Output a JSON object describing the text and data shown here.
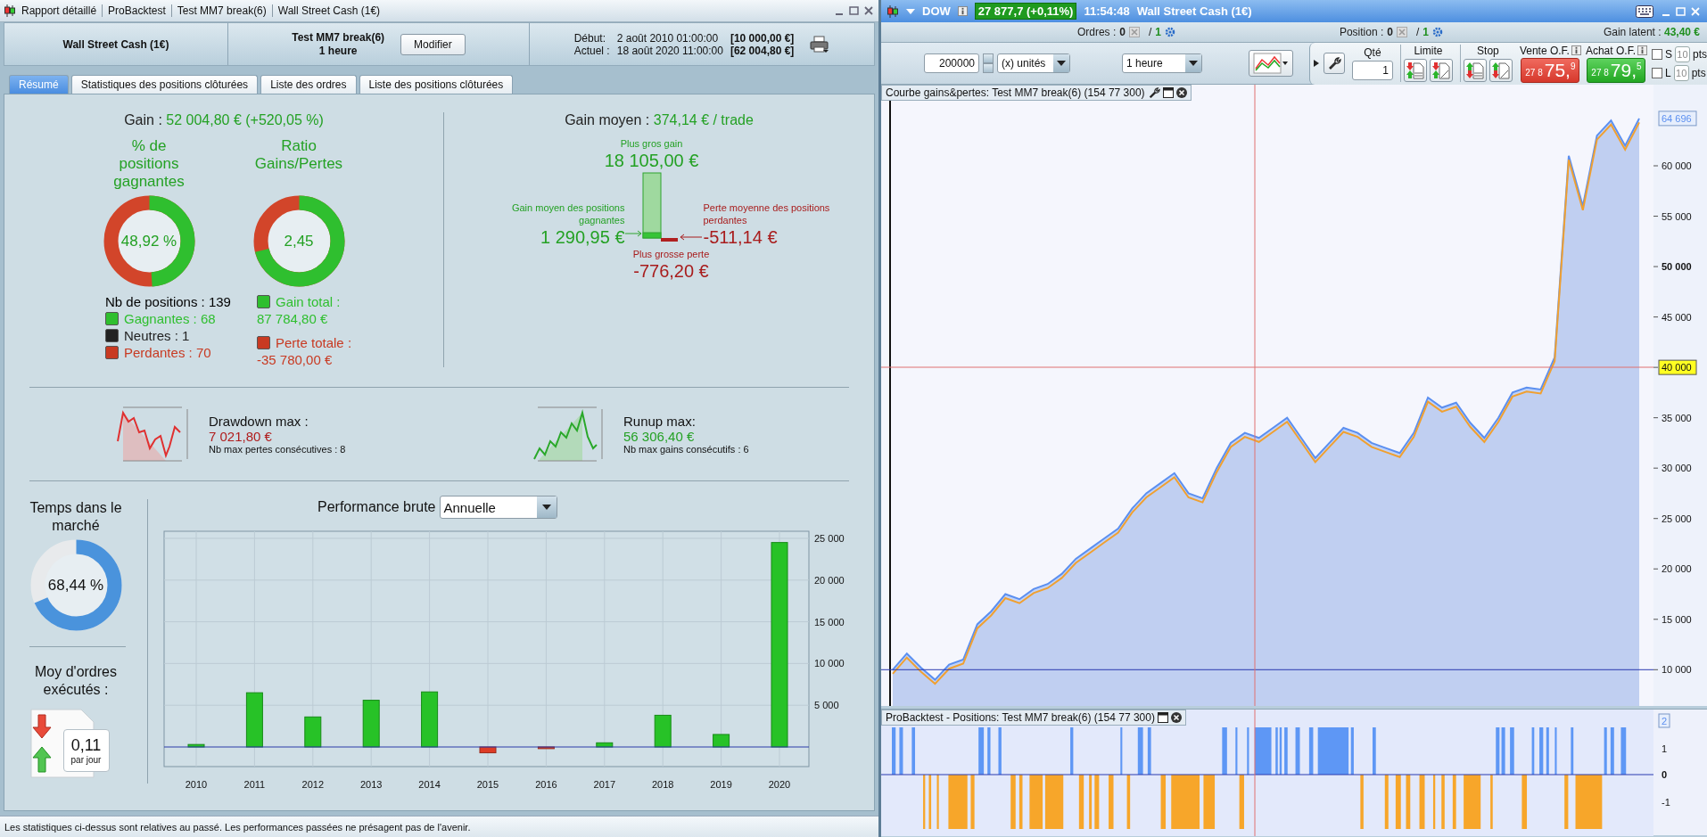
{
  "report_window": {
    "title_items": [
      "Rapport détaillé",
      "ProBacktest",
      "Test MM7 break(6)",
      "Wall Street Cash (1€)"
    ],
    "header": {
      "instrument": "Wall Street Cash (1€)",
      "strategy": "Test MM7 break(6)",
      "timeframe": "1 heure",
      "modify_button": "Modifier",
      "start_label": "Début:",
      "start_date": "2 août 2010 01:00:00",
      "start_value": "[10 000,00 €]",
      "current_label": "Actuel :",
      "current_date": "18 août 2020 11:00:00",
      "current_value": "[62 004,80 €]"
    },
    "tabs": [
      {
        "label": "Résumé",
        "selected": true
      },
      {
        "label": "Statistiques des positions clôturées",
        "selected": false
      },
      {
        "label": "Liste des ordres",
        "selected": false
      },
      {
        "label": "Liste des positions clôturées",
        "selected": false
      }
    ],
    "summary": {
      "gain_label": "Gain :",
      "gain_value": "52 004,80 € (+520,05 %)",
      "win_rate": {
        "title": "% de positions gagnantes",
        "value": "48,92 %",
        "level": 0.4892
      },
      "ratio": {
        "title": "Ratio Gains/Pertes",
        "value": "2,45",
        "level": 0.71
      },
      "positions_count": "Nb de positions : 139",
      "legend": [
        {
          "label": "Gagnantes : 68",
          "color": "#2fbf2f"
        },
        {
          "label": "Neutres : 1",
          "color": "#222222"
        },
        {
          "label": "Perdantes : 70",
          "color": "#c83a22"
        }
      ],
      "totals": [
        {
          "label": "Gain total :",
          "value": "87 784,80 €",
          "color": "#2fbf2f"
        },
        {
          "label": "Perte totale :",
          "value": "-35 780,00 €",
          "color": "#c83a22"
        }
      ],
      "avg_gain_label": "Gain moyen :",
      "avg_gain_value": "374,14 € / trade",
      "best_label": "Plus gros gain",
      "best_value": "18 105,00 €",
      "avg_win_label": "Gain moyen des positions gagnantes",
      "avg_win_value": "1 290,95 €",
      "avg_loss_label": "Perte moyenne des positions perdantes",
      "avg_loss_value": "-511,14 €",
      "worst_label": "Plus grosse perte",
      "worst_value": "-776,20 €",
      "drawdown": {
        "title": "Drawdown max :",
        "value": "7 021,80 €",
        "detail": "Nb max pertes consécutives : 8"
      },
      "runup": {
        "title": "Runup max:",
        "value": "56 306,40 €",
        "detail": "Nb max gains consécutifs : 6"
      },
      "time_in_market": {
        "title": "Temps dans le marché",
        "value": "68,44 %",
        "level": 0.6844
      },
      "orders": {
        "title": "Moy d'ordres exécutés :",
        "value": "0,11",
        "unit": "par jour"
      },
      "performance": {
        "label": "Performance brute",
        "period": "Annuelle",
        "chart_data": {
          "type": "bar",
          "categories": [
            "2010",
            "2011",
            "2012",
            "2013",
            "2014",
            "2015",
            "2016",
            "2017",
            "2018",
            "2019",
            "2020"
          ],
          "values": [
            300,
            6500,
            3600,
            5600,
            6600,
            -700,
            -200,
            500,
            3800,
            1500,
            24500
          ],
          "ylim": [
            -2350,
            25850
          ],
          "grid": true,
          "yticks": [
            {
              "value": 5000,
              "label": "5 000"
            },
            {
              "value": 10000,
              "label": "10 000"
            },
            {
              "value": 15000,
              "label": "15 000"
            },
            {
              "value": 20000,
              "label": "20 000"
            },
            {
              "value": 25000,
              "label": "25 000"
            }
          ],
          "ref_lines": [
            {
              "axis": "y",
              "value": 0
            }
          ]
        }
      }
    },
    "status_bar": "Les statistiques ci-dessus sont relatives au passé. Les performances passées ne présagent pas de l'avenir."
  },
  "chart_window": {
    "symbol": "DOW",
    "price": "27 877,7 (+0,11%)",
    "time": "11:54:48",
    "title": "Wall Street Cash (1€)",
    "orders": {
      "label": "Ordres :",
      "count": "0",
      "separator": "/",
      "total": "1"
    },
    "position": {
      "label": "Position :",
      "count": "0",
      "separator": "/",
      "total": "1"
    },
    "latent_gain": {
      "label": "Gain latent :",
      "value": "43,40 €"
    },
    "toolbar": {
      "quantity": "200000",
      "unit": "(x) unités",
      "timeframe": "1 heure",
      "qty_label": "Qté",
      "qty_value": "1",
      "limit_label": "Limite",
      "stop_label": "Stop",
      "sell": {
        "label": "Vente O.F.",
        "price_small": "27 8",
        "price_big": "75,",
        "price_sup": "9"
      },
      "buy": {
        "label": "Achat O.F.",
        "price_small": "27 8",
        "price_big": "79,",
        "price_sup": "5"
      },
      "stops": [
        {
          "label": "S",
          "value": "10",
          "unit": "pts",
          "checked": false,
          "disabled": true
        },
        {
          "label": "L",
          "value": "10",
          "unit": "pts",
          "checked": false,
          "disabled": true
        }
      ]
    },
    "equity_chart": {
      "title": "Courbe gains&pertes: Test MM7 break(6) (154 77 300)",
      "chart_data": {
        "type": "area",
        "ylim": [
          6400,
          68050
        ],
        "yticks": [
          {
            "value": 10000,
            "label": "10 000"
          },
          {
            "value": 15000,
            "label": "15 000"
          },
          {
            "value": 20000,
            "label": "20 000"
          },
          {
            "value": 25000,
            "label": "25 000"
          },
          {
            "value": 30000,
            "label": "30 000"
          },
          {
            "value": 35000,
            "label": "35 000"
          },
          {
            "value": 40000,
            "label": "40 000"
          },
          {
            "value": 45000,
            "label": "45 000"
          },
          {
            "value": 50000,
            "label": "50 000"
          },
          {
            "value": 55000,
            "label": "55 000"
          },
          {
            "value": 60000,
            "label": "60 000"
          }
        ],
        "series": [
          {
            "color": "#5b8ff0",
            "values": [
              10000,
              11600,
              10200,
              9000,
              10500,
              11000,
              14500,
              15800,
              17500,
              17000,
              18000,
              18500,
              19500,
              21000,
              22000,
              23000,
              24000,
              26000,
              27500,
              28500,
              29500,
              27500,
              27000,
              30000,
              32500,
              33500,
              33000,
              34000,
              35000,
              33000,
              31000,
              32500,
              34000,
              33500,
              32500,
              32000,
              31500,
              33500,
              37000,
              36000,
              36500,
              34500,
              33000,
              35000,
              37500,
              38000,
              37800,
              41000,
              61000,
              56000,
              63000,
              64500,
              62000,
              64700
            ]
          },
          {
            "color": "#f0a030",
            "values": [
              9600,
              11200,
              9800,
              8600,
              10100,
              10600,
              14100,
              15400,
              17100,
              16600,
              17600,
              18100,
              19100,
              20600,
              21600,
              22600,
              23600,
              25600,
              27100,
              28100,
              29100,
              27100,
              26600,
              29600,
              32100,
              33100,
              32600,
              33600,
              34600,
              32600,
              30600,
              32100,
              33600,
              33100,
              32100,
              31600,
              31100,
              33100,
              36600,
              35600,
              36100,
              34100,
              32600,
              34600,
              37100,
              37600,
              37400,
              40600,
              60600,
              55600,
              62600,
              64100,
              61600,
              64300
            ]
          }
        ],
        "ref_lines": [
          {
            "axis": "y",
            "value": 10000
          }
        ]
      },
      "last_value_label": "64 696",
      "crosshair": {
        "visible": true
      }
    },
    "positions_chart": {
      "title": "ProBacktest - Positions: Test MM7 break(6) (154 77 300)",
      "y_labels": [
        {
          "text": "2",
          "kind": "last"
        },
        {
          "text": "1",
          "kind": "tick"
        },
        {
          "text": "0",
          "kind": "major"
        },
        {
          "text": "-1",
          "kind": "tick"
        }
      ]
    }
  }
}
